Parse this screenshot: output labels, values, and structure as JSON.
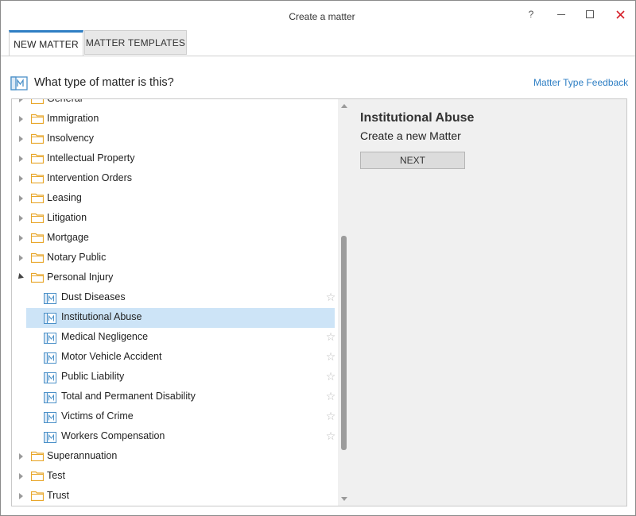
{
  "window": {
    "title": "Create a matter",
    "help_label": "?",
    "close_color": "#d6202a"
  },
  "tabs": [
    {
      "label": "NEW MATTER",
      "active": true
    },
    {
      "label": "MATTER TEMPLATES",
      "active": false
    }
  ],
  "header": {
    "question": "What type of matter is this?",
    "feedback_link": "Matter Type Feedback",
    "accent": "#2f7fc4"
  },
  "tree": {
    "items": [
      {
        "label": "General",
        "kind": "folder",
        "level": 0,
        "state": "collapsed"
      },
      {
        "label": "Immigration",
        "kind": "folder",
        "level": 0,
        "state": "collapsed"
      },
      {
        "label": "Insolvency",
        "kind": "folder",
        "level": 0,
        "state": "collapsed"
      },
      {
        "label": "Intellectual Property",
        "kind": "folder",
        "level": 0,
        "state": "collapsed"
      },
      {
        "label": "Intervention Orders",
        "kind": "folder",
        "level": 0,
        "state": "collapsed"
      },
      {
        "label": "Leasing",
        "kind": "folder",
        "level": 0,
        "state": "collapsed"
      },
      {
        "label": "Litigation",
        "kind": "folder",
        "level": 0,
        "state": "collapsed"
      },
      {
        "label": "Mortgage",
        "kind": "folder",
        "level": 0,
        "state": "collapsed"
      },
      {
        "label": "Notary Public",
        "kind": "folder",
        "level": 0,
        "state": "collapsed"
      },
      {
        "label": "Personal Injury",
        "kind": "folder",
        "level": 0,
        "state": "expanded"
      },
      {
        "label": "Dust Diseases",
        "kind": "matter",
        "level": 1,
        "selected": false
      },
      {
        "label": "Institutional Abuse",
        "kind": "matter",
        "level": 1,
        "selected": true
      },
      {
        "label": "Medical Negligence",
        "kind": "matter",
        "level": 1,
        "selected": false
      },
      {
        "label": "Motor Vehicle Accident",
        "kind": "matter",
        "level": 1,
        "selected": false
      },
      {
        "label": "Public Liability",
        "kind": "matter",
        "level": 1,
        "selected": false
      },
      {
        "label": "Total and Permanent Disability",
        "kind": "matter",
        "level": 1,
        "selected": false
      },
      {
        "label": "Victims of Crime",
        "kind": "matter",
        "level": 1,
        "selected": false
      },
      {
        "label": "Workers Compensation",
        "kind": "matter",
        "level": 1,
        "selected": false
      },
      {
        "label": "Superannuation",
        "kind": "folder",
        "level": 0,
        "state": "collapsed"
      },
      {
        "label": "Test",
        "kind": "folder",
        "level": 0,
        "state": "collapsed"
      },
      {
        "label": "Trust",
        "kind": "folder",
        "level": 0,
        "state": "collapsed"
      }
    ],
    "folder_color": "#e8a72c",
    "matter_icon_color": "#4a90c8",
    "selected_color": "#cde4f7",
    "scroll_position": 0.74
  },
  "detail": {
    "title": "Institutional Abuse",
    "subtitle": "Create a new Matter",
    "next_button": "NEXT"
  }
}
